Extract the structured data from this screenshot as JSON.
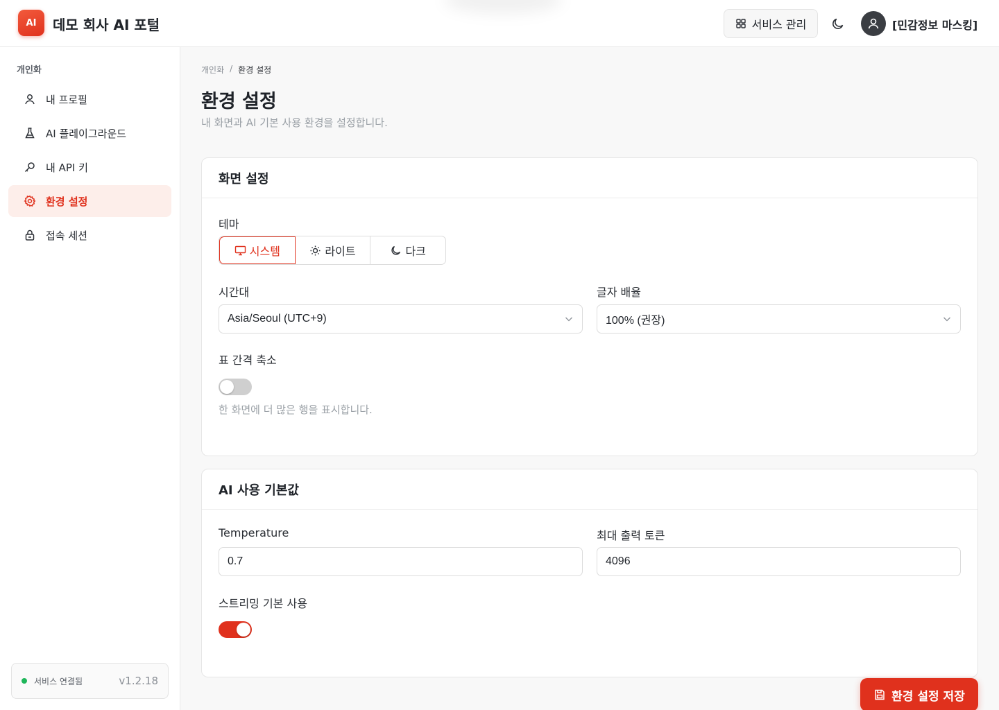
{
  "header": {
    "logo": "AI",
    "title": "데모 회사 AI 포털",
    "service_button": "서비스 관리",
    "user_name": "[민감정보 마스킹]"
  },
  "sidebar": {
    "section": "개인화",
    "items": [
      {
        "label": "내 프로필",
        "icon": "user-icon"
      },
      {
        "label": "AI 플레이그라운드",
        "icon": "flask-icon"
      },
      {
        "label": "내 API 키",
        "icon": "key-icon"
      },
      {
        "label": "환경 설정",
        "icon": "gear-icon",
        "active": true
      },
      {
        "label": "접속 세션",
        "icon": "lock-icon"
      }
    ],
    "status": "서비스 연결됨",
    "version": "v1.2.18"
  },
  "breadcrumb": {
    "parent": "개인화",
    "separator": "/",
    "current": "환경 설정"
  },
  "page": {
    "title": "환경 설정",
    "description": "내 화면과 AI 기본 사용 환경을 설정합니다."
  },
  "display": {
    "title": "화면 설정",
    "theme_label": "테마",
    "theme_options": [
      "시스템",
      "라이트",
      "다크"
    ],
    "theme_selected": "시스템",
    "timezone_label": "시간대",
    "timezone_value": "Asia/Seoul (UTC+9)",
    "font_scale_label": "글자 배율",
    "font_scale_value": "100% (권장)",
    "compact_label": "표 간격 축소",
    "compact_enabled": false,
    "compact_hint": "한 화면에 더 많은 행을 표시합니다."
  },
  "ai_defaults": {
    "title": "AI 사용 기본값",
    "temperature_label": "Temperature",
    "temperature_value": "0.7",
    "max_tokens_label": "최대 출력 토큰",
    "max_tokens_value": "4096",
    "streaming_label": "스트리밍 기본 사용",
    "streaming_enabled": true
  },
  "save_button": "환경 설정 저장",
  "colors": {
    "accent": "#e0311d",
    "accent_soft": "#fdeeea",
    "status_ok": "#1fb65a"
  }
}
